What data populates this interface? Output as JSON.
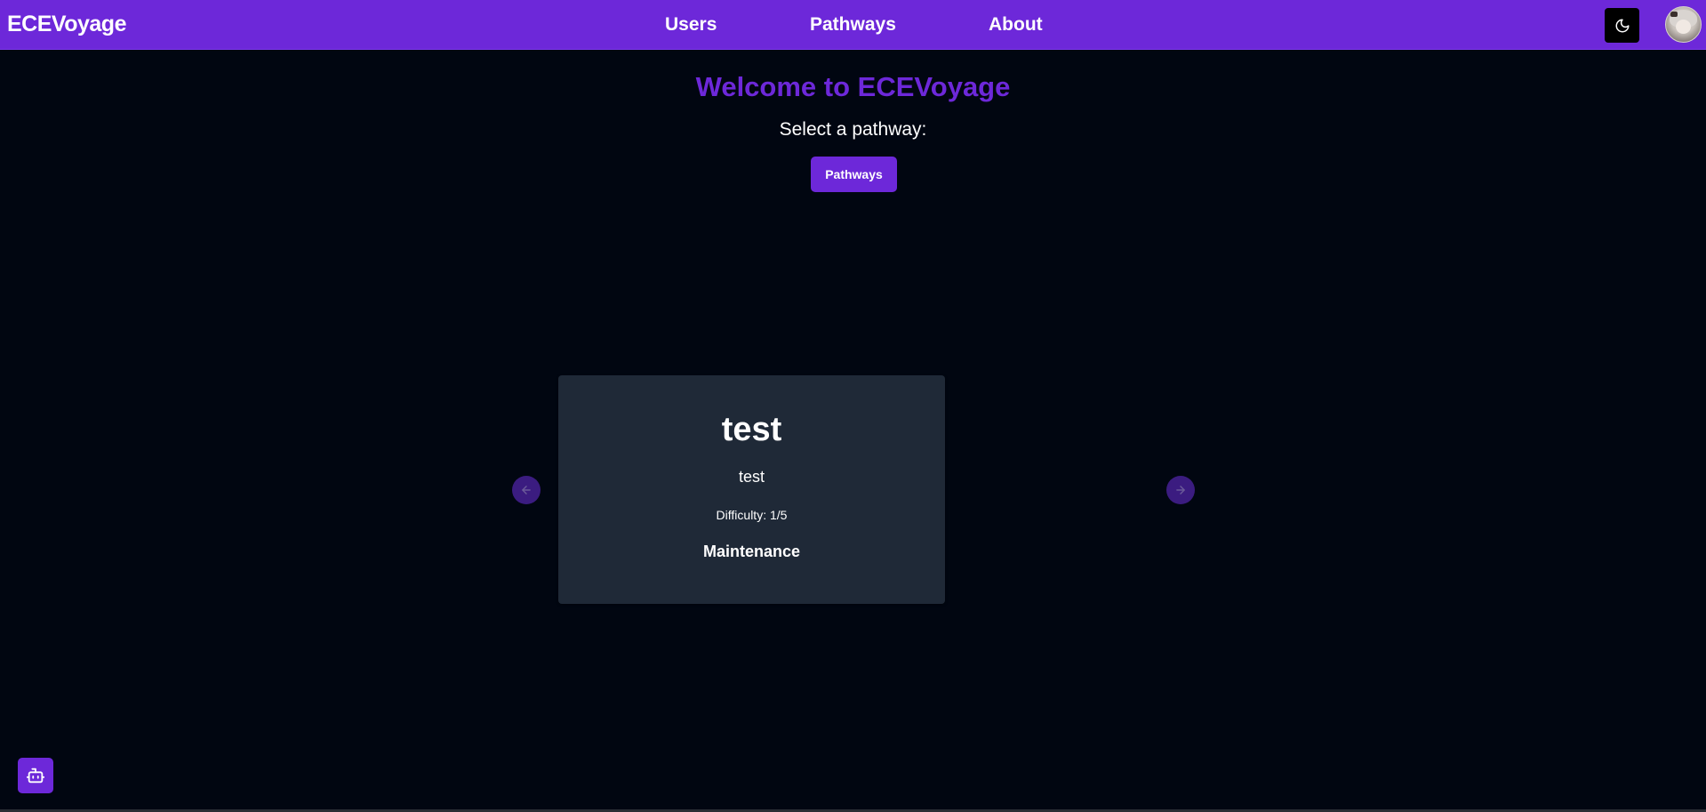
{
  "navbar": {
    "brand": "ECEVoyage",
    "links": [
      {
        "label": "Users"
      },
      {
        "label": "Pathways"
      },
      {
        "label": "About"
      }
    ],
    "theme_icon": "moon-icon",
    "accent_color": "#6d28d9"
  },
  "main": {
    "welcome": "Welcome to ECEVoyage",
    "subtitle": "Select a pathway:",
    "pathways_button": "Pathways"
  },
  "carousel": {
    "prev_icon": "arrow-left-icon",
    "next_icon": "arrow-right-icon",
    "card": {
      "title": "test",
      "description": "test",
      "difficulty": "Difficulty: 1/5",
      "category": "Maintenance",
      "background": "#1f2937"
    }
  },
  "assistant": {
    "icon": "robot-icon"
  },
  "colors": {
    "background": "#010611",
    "primary": "#6d28d9",
    "carousel_button": "#3b1c80"
  }
}
